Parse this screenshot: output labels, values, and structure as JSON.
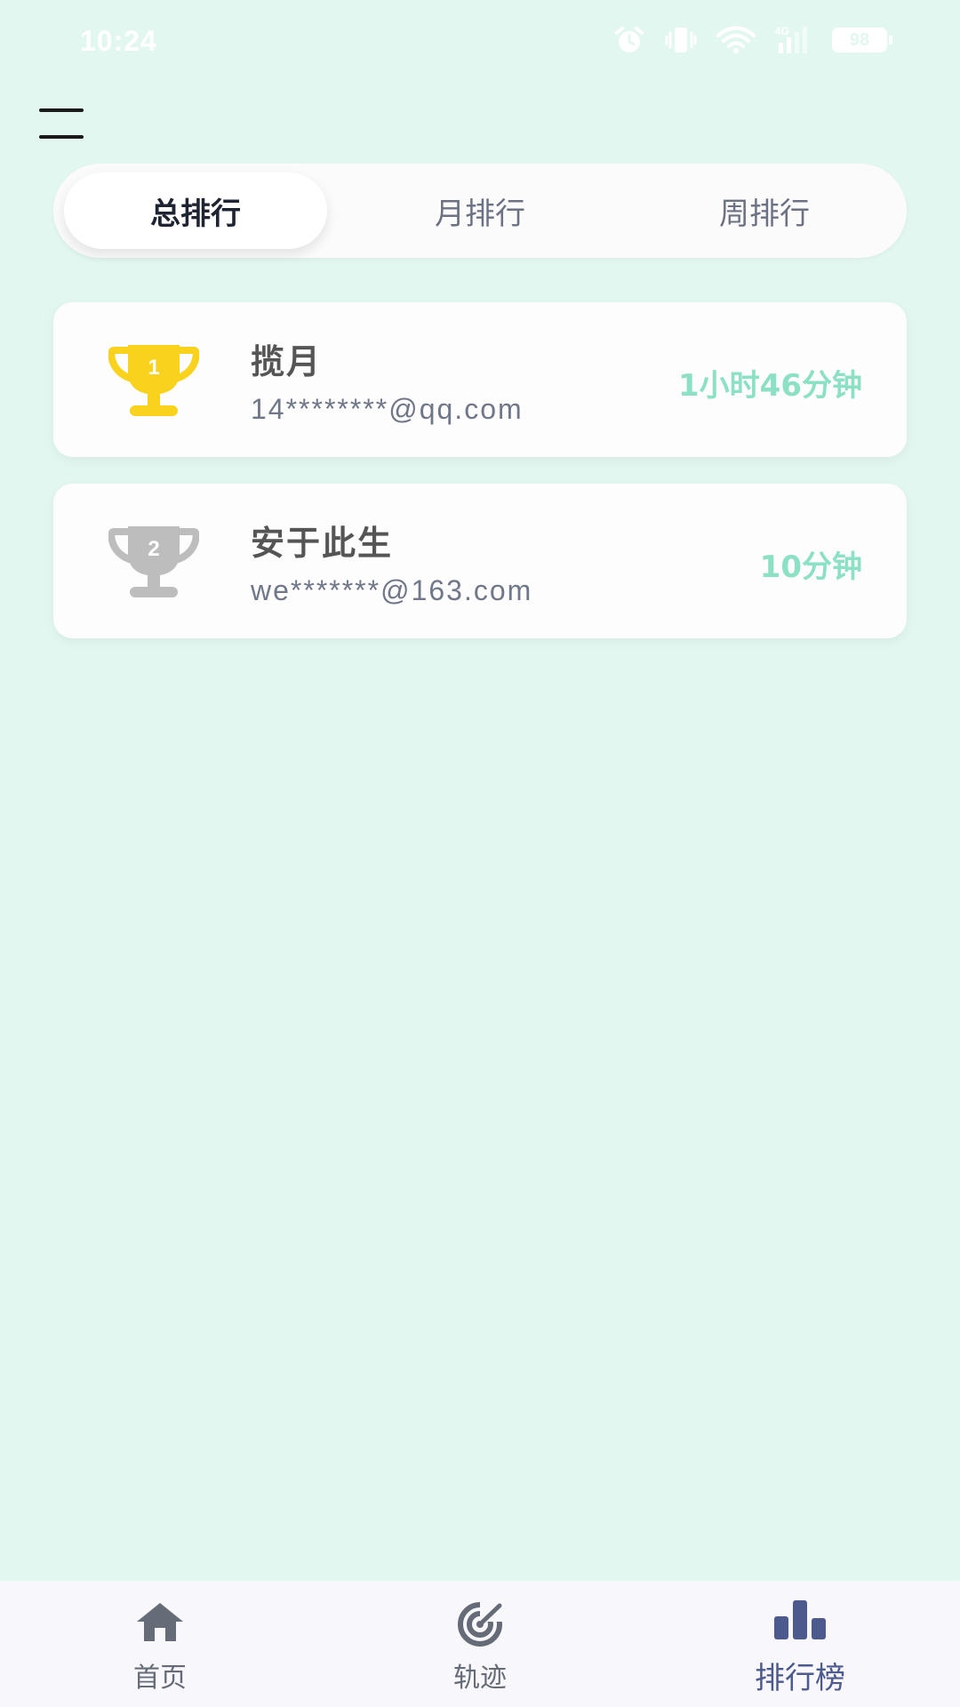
{
  "status_bar": {
    "time": "10:24",
    "network": "4G",
    "battery": "98",
    "icons": [
      "alarm-icon",
      "vibrate-icon",
      "wifi-icon",
      "signal-icon",
      "battery-icon"
    ]
  },
  "menu": {
    "icon": "hamburger-menu-icon"
  },
  "tabs": [
    {
      "label": "总排行",
      "active": true
    },
    {
      "label": "月排行",
      "active": false
    },
    {
      "label": "周排行",
      "active": false
    }
  ],
  "rankings": [
    {
      "rank": "1",
      "name": "揽月",
      "email": "14********@qq.com",
      "duration": "1小时46分钟",
      "trophy_color": "#f8d21c"
    },
    {
      "rank": "2",
      "name": "安于此生",
      "email": "we*******@163.com",
      "duration": "10分钟",
      "trophy_color": "#bdbdbd"
    }
  ],
  "bottom_nav": [
    {
      "label": "首页",
      "icon": "home-icon",
      "active": false
    },
    {
      "label": "轨迹",
      "icon": "track-icon",
      "active": false
    },
    {
      "label": "排行榜",
      "icon": "ranking-icon",
      "active": true
    }
  ],
  "colors": {
    "background": "#e2f7ef",
    "accent": "#8ce0c4",
    "nav_active": "#4c5a8d",
    "gold": "#f8d21c",
    "silver": "#bdbdbd"
  }
}
